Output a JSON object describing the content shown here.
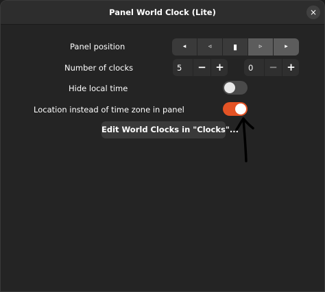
{
  "window": {
    "title": "Panel World Clock (Lite)",
    "close_glyph": "×"
  },
  "panel_position": {
    "label": "Panel position",
    "buttons": [
      {
        "glyph": "◂",
        "icon": "arrow-left-filled-icon",
        "active": false
      },
      {
        "glyph": "◃",
        "icon": "arrow-left-outline-icon",
        "active": false
      },
      {
        "glyph": "▮",
        "icon": "center-bar-icon",
        "active": false
      },
      {
        "glyph": "▹",
        "icon": "arrow-right-outline-icon",
        "active": true
      },
      {
        "glyph": "▸",
        "icon": "arrow-right-filled-icon",
        "active": true
      }
    ]
  },
  "number_of_clocks": {
    "label": "Number of clocks",
    "first": {
      "value": "5",
      "minus": "−",
      "plus": "+"
    },
    "second": {
      "value": "0",
      "minus": "−",
      "plus": "+"
    }
  },
  "hide_local_time": {
    "label": "Hide local time",
    "on": false
  },
  "location_in_panel": {
    "label": "Location instead of time zone in panel",
    "on": true
  },
  "edit_button": {
    "label": "Edit World Clocks in \"Clocks\"..."
  },
  "colors": {
    "accent": "#e45325",
    "background": "#242424",
    "button": "#3a3a3a"
  }
}
